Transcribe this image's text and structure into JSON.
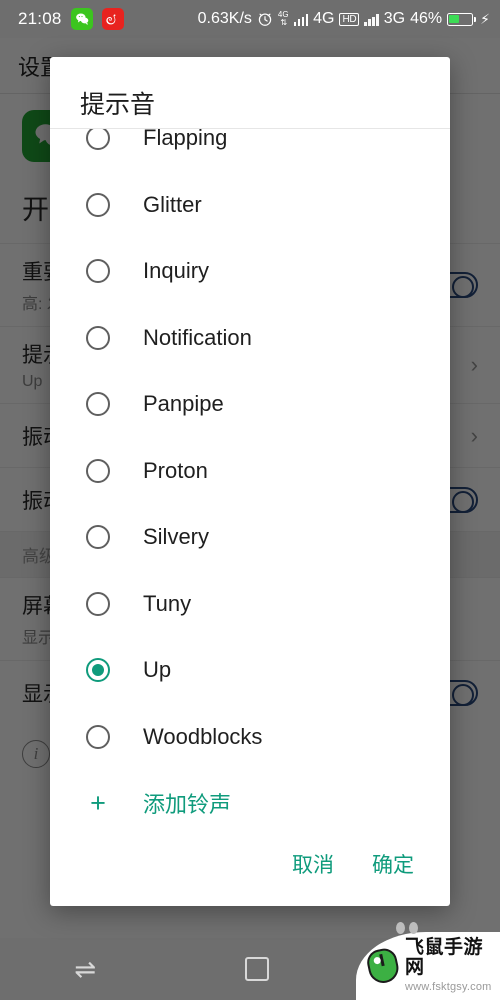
{
  "status_bar": {
    "clock": "21:08",
    "network_speed": "0.63K/s",
    "alarm_icon": "alarm-clock-icon",
    "sim1_label": "4G",
    "volte_label": "HD",
    "sim2_label": "3G",
    "data_label_small": "4G",
    "battery_percent": "46%",
    "charging_icon": "⚡",
    "app_icons": [
      {
        "name": "wechat-icon",
        "glyph": "💬"
      },
      {
        "name": "netease-music-icon",
        "glyph": "♫"
      }
    ]
  },
  "background_page": {
    "app_bar_title": "设置",
    "app_icon_glyph": "💬",
    "section_title": "开启通知",
    "rows": [
      {
        "title": "重要",
        "subtitle": "高: 发出声音",
        "control": "switch"
      },
      {
        "title": "提示音",
        "subtitle": "Up",
        "control": "chevron"
      },
      {
        "title": "振动",
        "subtitle": "",
        "control": "chevron"
      },
      {
        "title": "振动提醒",
        "subtitle": "",
        "control": "switch"
      }
    ],
    "group_header": "高级",
    "advanced_rows": [
      {
        "title": "屏幕锁定时",
        "subtitle": "显示全部通知内容",
        "control": "none"
      },
      {
        "title": "显示图标标记",
        "subtitle": "",
        "control": "switch"
      }
    ],
    "info_icon": "info-icon"
  },
  "dialog": {
    "title": "提示音",
    "items": [
      {
        "label": "Flapping",
        "selected": false,
        "clipped": true
      },
      {
        "label": "Glitter",
        "selected": false
      },
      {
        "label": "Inquiry",
        "selected": false
      },
      {
        "label": "Notification",
        "selected": false
      },
      {
        "label": "Panpipe",
        "selected": false
      },
      {
        "label": "Proton",
        "selected": false
      },
      {
        "label": "Silvery",
        "selected": false
      },
      {
        "label": "Tuny",
        "selected": false
      },
      {
        "label": "Up",
        "selected": true
      },
      {
        "label": "Woodblocks",
        "selected": false
      }
    ],
    "add_ringtone": {
      "icon": "plus-icon",
      "label": "添加铃声"
    },
    "cancel_label": "取消",
    "confirm_label": "确定",
    "accent_color": "#0f9b7c"
  },
  "nav_bar": {
    "recents_icon": "recents-swap-icon",
    "home_icon": "home-square-icon",
    "back_icon": "back-icon"
  },
  "watermark": {
    "site_name": "飞鼠手游网",
    "site_url": "www.fsktgsy.com",
    "logo_icon": "mouse-logo-icon"
  }
}
